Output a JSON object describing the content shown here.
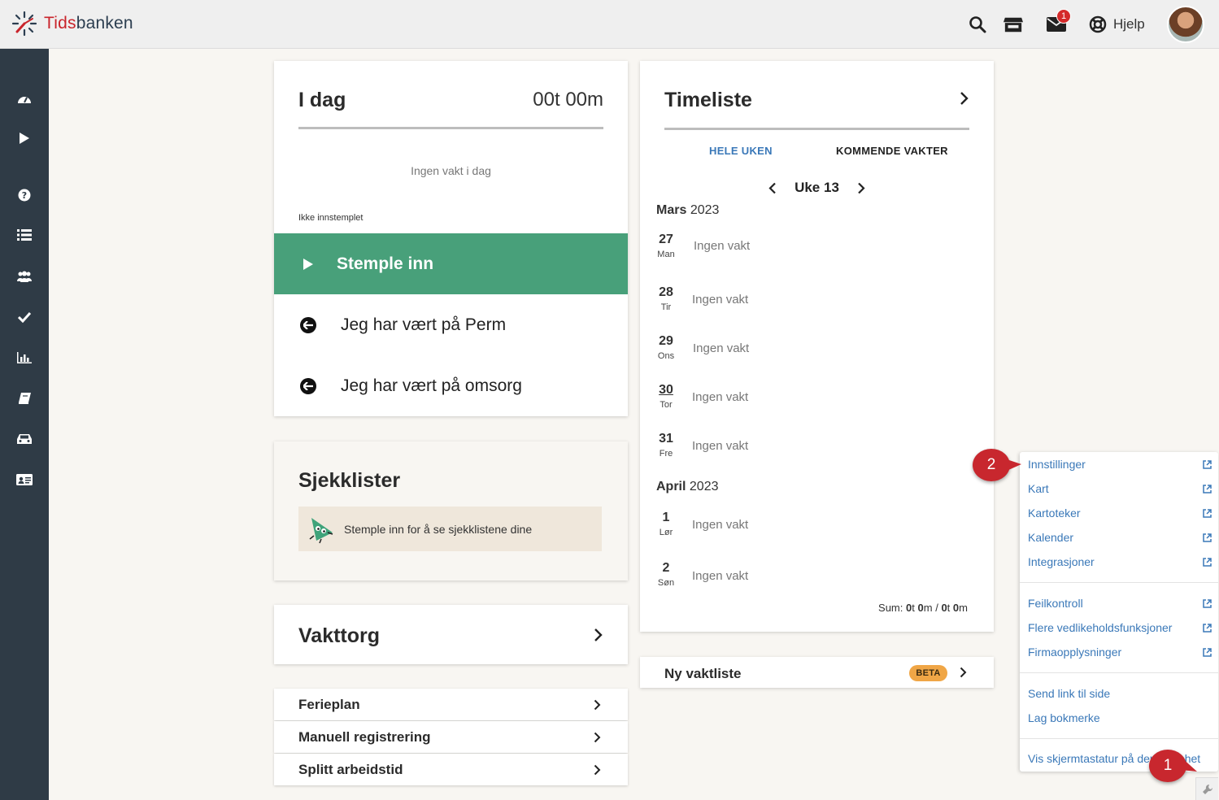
{
  "app": {
    "logo_prefix": "Tids",
    "logo_suffix": "banken",
    "help_label": "Hjelp",
    "notification_count": "1"
  },
  "sidebar": {
    "items": [
      "dashboard-icon",
      "play-icon",
      "question-icon",
      "list-icon",
      "users-icon",
      "check-icon",
      "bar-chart-icon",
      "book-icon",
      "car-icon",
      "id-card-icon"
    ]
  },
  "today": {
    "title": "I dag",
    "time": "00t 00m",
    "no_shift": "Ingen vakt i dag",
    "status": "Ikke innstemplet",
    "stamp_in": "Stemple inn",
    "option_perm": "Jeg har vært på Perm",
    "option_omsorg": "Jeg har vært på omsorg"
  },
  "checklists": {
    "title": "Sjekklister",
    "message": "Stemple inn for å se sjekklistene dine"
  },
  "vakttorg": {
    "title": "Vakttorg"
  },
  "links": [
    {
      "label": "Ferieplan"
    },
    {
      "label": "Manuell registrering"
    },
    {
      "label": "Splitt arbeidstid"
    }
  ],
  "timesheet": {
    "title": "Timeliste",
    "tab_week": "HELE UKEN",
    "tab_upcoming": "KOMMENDE VAKTER",
    "week": "Uke 13",
    "months": [
      {
        "name": "Mars",
        "year": "2023"
      },
      {
        "name": "April",
        "year": "2023"
      }
    ],
    "days": [
      {
        "num": "27",
        "name": "Man",
        "status": "Ingen vakt"
      },
      {
        "num": "28",
        "name": "Tir",
        "status": "Ingen vakt"
      },
      {
        "num": "29",
        "name": "Ons",
        "status": "Ingen vakt"
      },
      {
        "num": "30",
        "name": "Tor",
        "status": "Ingen vakt"
      },
      {
        "num": "31",
        "name": "Fre",
        "status": "Ingen vakt"
      },
      {
        "num": "1",
        "name": "Lør",
        "status": "Ingen vakt"
      },
      {
        "num": "2",
        "name": "Søn",
        "status": "Ingen vakt"
      }
    ],
    "sum_label": "Sum:",
    "sum_a_h": "0",
    "sum_a_m": "0",
    "sum_b_h": "0",
    "sum_b_m": "0",
    "unit_t": "t",
    "unit_m": "m",
    "sum_sep": "/"
  },
  "new_roster": {
    "title": "Ny vaktliste",
    "badge": "BETA"
  },
  "menu": {
    "items": [
      {
        "label": "Innstillinger"
      },
      {
        "label": "Kart"
      },
      {
        "label": "Kartoteker"
      },
      {
        "label": "Kalender"
      },
      {
        "label": "Integrasjoner"
      },
      {
        "label": "Feilkontroll"
      },
      {
        "label": "Flere vedlikeholdsfunksjoner"
      },
      {
        "label": "Firmaopplysninger"
      },
      {
        "label": "Send link til side"
      },
      {
        "label": "Lag bokmerke"
      },
      {
        "label": "Vis skjermtastatur på denne enhet"
      }
    ]
  },
  "callouts": {
    "one": "1",
    "two": "2"
  },
  "colors": {
    "brand_red": "#c9242b",
    "sidebar": "#2f3b46",
    "stamp_green": "#48a07a",
    "link_blue": "#3a78b8",
    "beta_orange": "#f0a646"
  }
}
